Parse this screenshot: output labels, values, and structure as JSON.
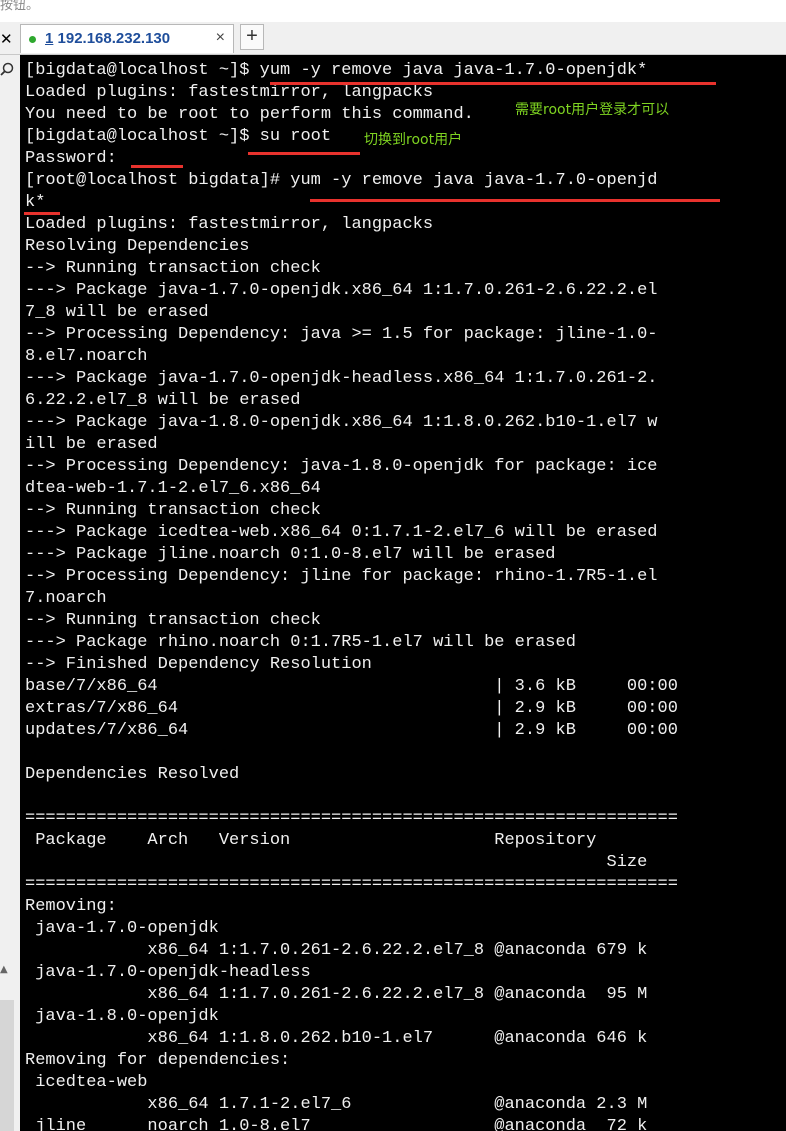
{
  "window": {
    "top_strip_text": "按钮。",
    "close_glyph": "✕",
    "tab": {
      "number": "1",
      "host": " 192.168.232.130",
      "close_glyph": "×"
    },
    "add_tab_glyph": "+"
  },
  "terminal": {
    "lines": [
      "[bigdata@localhost ~]$ yum -y remove java java-1.7.0-openjdk*",
      "Loaded plugins: fastestmirror, langpacks",
      "You need to be root to perform this command.",
      "[bigdata@localhost ~]$ su root",
      "Password:",
      "[root@localhost bigdata]# yum -y remove java java-1.7.0-openjd",
      "k*",
      "Loaded plugins: fastestmirror, langpacks",
      "Resolving Dependencies",
      "--> Running transaction check",
      "---> Package java-1.7.0-openjdk.x86_64 1:1.7.0.261-2.6.22.2.el",
      "7_8 will be erased",
      "--> Processing Dependency: java >= 1.5 for package: jline-1.0-",
      "8.el7.noarch",
      "---> Package java-1.7.0-openjdk-headless.x86_64 1:1.7.0.261-2.",
      "6.22.2.el7_8 will be erased",
      "---> Package java-1.8.0-openjdk.x86_64 1:1.8.0.262.b10-1.el7 w",
      "ill be erased",
      "--> Processing Dependency: java-1.8.0-openjdk for package: ice",
      "dtea-web-1.7.1-2.el7_6.x86_64",
      "--> Running transaction check",
      "---> Package icedtea-web.x86_64 0:1.7.1-2.el7_6 will be erased",
      "---> Package jline.noarch 0:1.0-8.el7 will be erased",
      "--> Processing Dependency: jline for package: rhino-1.7R5-1.el",
      "7.noarch",
      "--> Running transaction check",
      "---> Package rhino.noarch 0:1.7R5-1.el7 will be erased",
      "--> Finished Dependency Resolution",
      "base/7/x86_64                                 | 3.6 kB     00:00",
      "extras/7/x86_64                               | 2.9 kB     00:00",
      "updates/7/x86_64                              | 2.9 kB     00:00",
      "",
      "Dependencies Resolved",
      "",
      "================================================================",
      " Package    Arch   Version                    Repository",
      "                                                         Size",
      "================================================================",
      "Removing:",
      " java-1.7.0-openjdk",
      "            x86_64 1:1.7.0.261-2.6.22.2.el7_8 @anaconda 679 k",
      " java-1.7.0-openjdk-headless",
      "            x86_64 1:1.7.0.261-2.6.22.2.el7_8 @anaconda  95 M",
      " java-1.8.0-openjdk",
      "            x86_64 1:1.8.0.262.b10-1.el7      @anaconda 646 k",
      "Removing for dependencies:",
      " icedtea-web",
      "            x86_64 1.7.1-2.el7_6              @anaconda 2.3 M",
      " jline      noarch 1.0-8.el7                  @anaconda  72 k"
    ]
  },
  "annotations": {
    "need_root": "需要root用户登录才可以",
    "switch_root": "切换到root用户"
  },
  "colors": {
    "terminal_bg": "#000000",
    "terminal_fg": "#f0f0f0",
    "annotation_green": "#7ed321",
    "underline_red": "#e8322d",
    "tab_text_blue": "#1f4e9b",
    "status_dot_green": "#2ea82e"
  },
  "icons": {
    "window_close": "close-icon",
    "status": "connected-dot-icon",
    "tab_close": "close-icon",
    "new_tab": "plus-icon",
    "find": "search-icon",
    "scroll_up": "chevron-up-icon"
  }
}
